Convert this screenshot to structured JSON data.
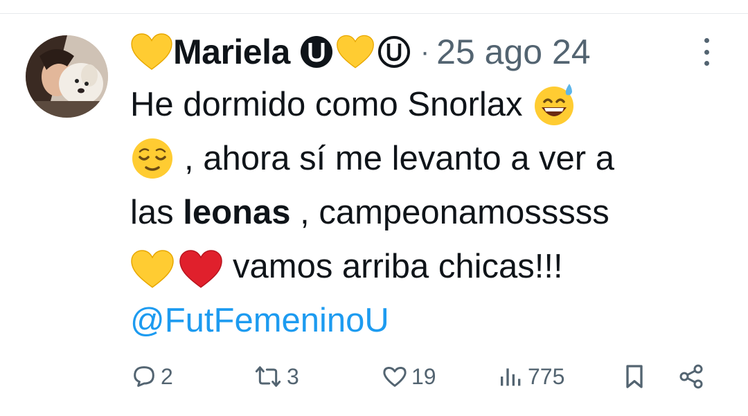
{
  "tweet": {
    "author_name": "Mariela",
    "separator": "·",
    "date": "25 ago 24",
    "text": {
      "line1": "He dormido como Snorlax",
      "line2": ", ahora sí me levanto a ver a",
      "line3_prefix": "las",
      "line3_bold": "leonas",
      "line3_suffix": ", campeonamosssss",
      "line4": "vamos arriba chicas!!!",
      "mention": "@FutFemeninoU"
    },
    "emojis": [
      "yellow-heart",
      "sweat-smile",
      "relieved-face",
      "red-heart"
    ],
    "badges": [
      "u-logo-filled",
      "u-logo-outline"
    ]
  },
  "actions": {
    "replies": "2",
    "retweets": "3",
    "likes": "19",
    "views": "775"
  },
  "colors": {
    "text": "#0f1419",
    "muted": "#536471",
    "link": "#1d9bf0",
    "heart_yellow": "#ffcc32",
    "heart_red": "#e0202c"
  }
}
